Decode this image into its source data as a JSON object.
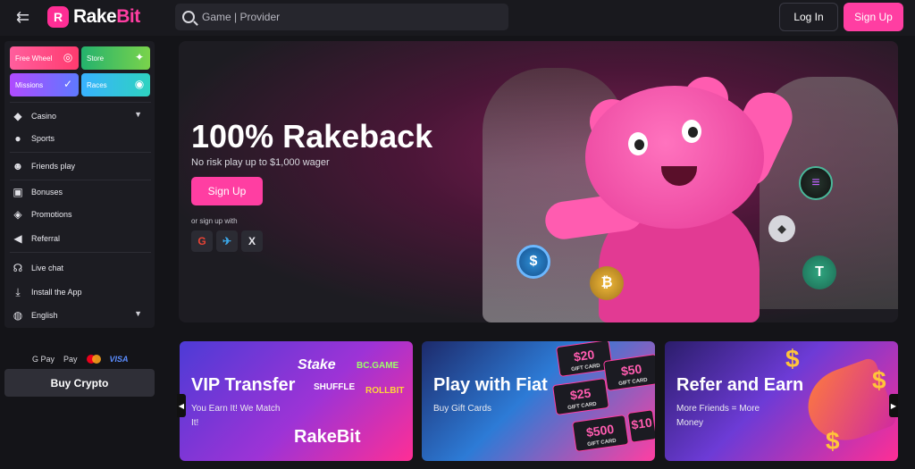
{
  "header": {
    "back_icon": "arrow-left-icon",
    "logo_mark": "R",
    "logo_text_a": "Rake",
    "logo_text_b": "Bit",
    "search_placeholder": "Game | Provider",
    "login_label": "Log In",
    "signup_label": "Sign Up"
  },
  "sidebar": {
    "tiles": [
      {
        "label": "Free Wheel",
        "icon": "wheel-icon"
      },
      {
        "label": "Store",
        "icon": "gift-icon"
      },
      {
        "label": "Missions",
        "icon": "checklist-icon"
      },
      {
        "label": "Races",
        "icon": "target-icon"
      }
    ],
    "items": [
      {
        "label": "Casino",
        "icon": "cube-icon",
        "has_caret": true
      },
      {
        "label": "Sports",
        "icon": "basketball-icon"
      },
      {
        "label": "Friends play",
        "icon": "users-icon"
      },
      {
        "label": "Bonuses",
        "icon": "gift-icon"
      },
      {
        "label": "Promotions",
        "icon": "tag-icon"
      },
      {
        "label": "Referral",
        "icon": "megaphone-icon"
      },
      {
        "label": "Live chat",
        "icon": "headset-icon"
      },
      {
        "label": "Install the App",
        "icon": "download-icon"
      },
      {
        "label": "English",
        "icon": "globe-icon",
        "has_caret": true
      }
    ]
  },
  "payments": {
    "gpay": "G Pay",
    "applepay": "Pay",
    "visa": "VISA"
  },
  "buy_crypto_label": "Buy Crypto",
  "hero": {
    "title": "100% Rakeback",
    "subtitle": "No risk play up to $1,000 wager",
    "signup_label": "Sign Up",
    "or_signup": "or sign up with",
    "socials": [
      "G",
      "✈",
      "X"
    ]
  },
  "promos": [
    {
      "title": "VIP Transfer",
      "subtitle": "You Earn It! We Match It!",
      "brands": [
        "Stake",
        "BC.GAME",
        "SHUFFLE",
        "ROLLBIT"
      ],
      "logo": "RakeBit"
    },
    {
      "title": "Play with Fiat",
      "subtitle": "Buy Gift Cards",
      "cards": [
        "$20",
        "$50",
        "$25",
        "$500",
        "$10"
      ],
      "card_caption": "GIFT CARD"
    },
    {
      "title": "Refer and Earn",
      "subtitle": "More Friends = More Money"
    }
  ],
  "colors": {
    "accent": "#ff3ea2",
    "bg": "#141418",
    "panel": "#1c1c22"
  }
}
